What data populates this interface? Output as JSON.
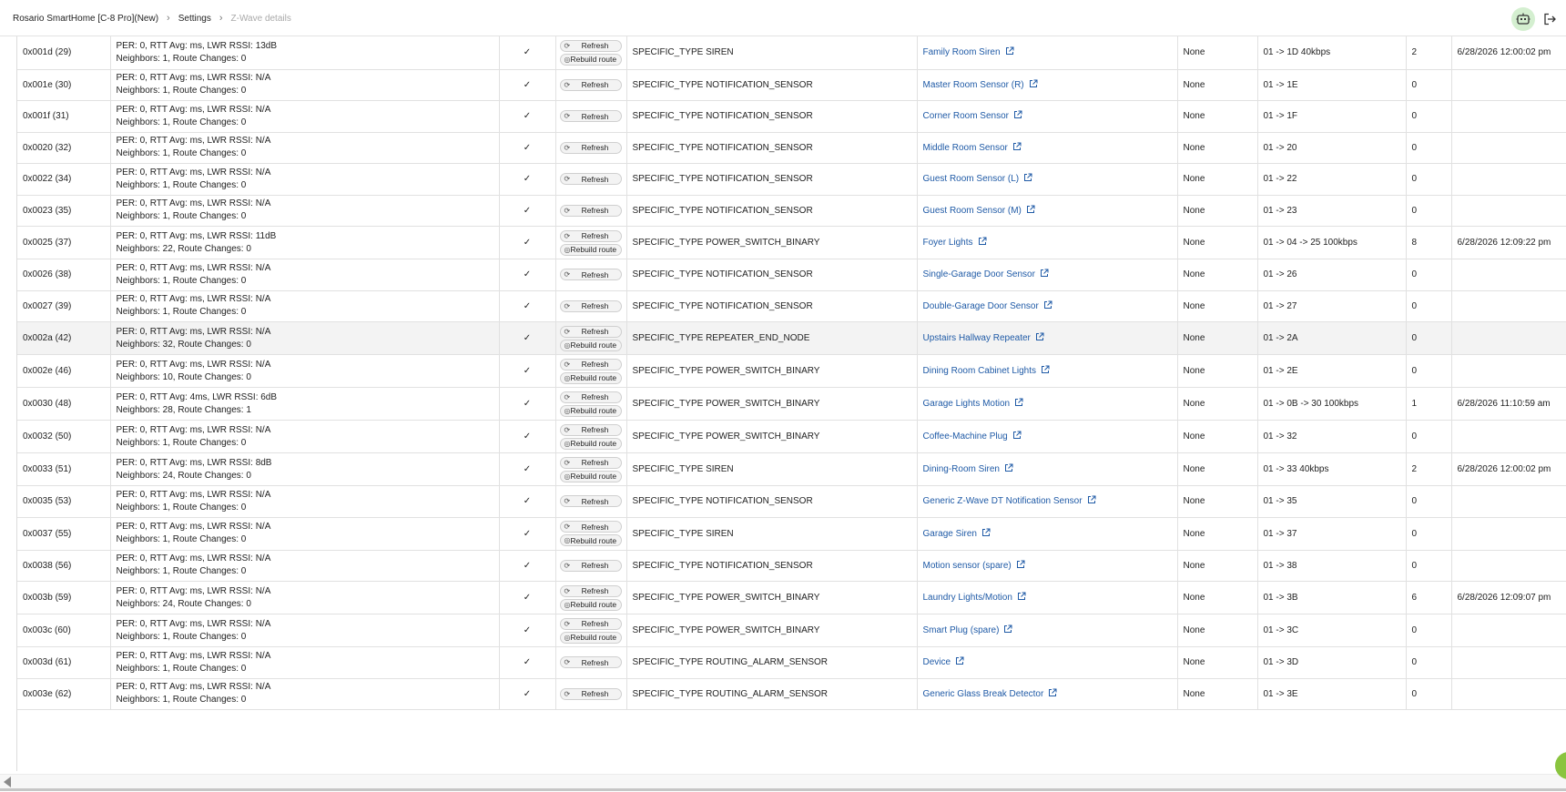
{
  "breadcrumb": {
    "hub": "Rosario SmartHome [C-8 Pro](New)",
    "settings": "Settings",
    "current": "Z-Wave details"
  },
  "header_icons": {
    "assistant": "robot-icon",
    "logout": "logout-icon",
    "assistant_bg": "#d4efd0"
  },
  "buttons": {
    "refresh": "Refresh",
    "rebuild": "Rebuild route"
  },
  "colors": {
    "link": "#1f5aa6",
    "highlight_row": "#f3f3f3",
    "fab": "#8ac43f"
  },
  "rows": [
    {
      "id": "0x001d (29)",
      "stats1": "PER: 0, RTT Avg: ms, LWR RSSI: 13dB",
      "stats2": "Neighbors: 1, Route Changes: 0",
      "ok": "✓",
      "rebuild": true,
      "type": "SPECIFIC_TYPE SIREN",
      "device": "Family Room Siren",
      "security": "None",
      "route": "01 -> 1D 40kbps",
      "count": "2",
      "time": "6/28/2026 12:00:02 pm"
    },
    {
      "id": "0x001e (30)",
      "stats1": "PER: 0, RTT Avg: ms, LWR RSSI: N/A",
      "stats2": "Neighbors: 1, Route Changes: 0",
      "ok": "✓",
      "rebuild": false,
      "type": "SPECIFIC_TYPE NOTIFICATION_SENSOR",
      "device": "Master Room Sensor (R)",
      "security": "None",
      "route": "01 -> 1E",
      "count": "0",
      "time": ""
    },
    {
      "id": "0x001f (31)",
      "stats1": "PER: 0, RTT Avg: ms, LWR RSSI: N/A",
      "stats2": "Neighbors: 1, Route Changes: 0",
      "ok": "✓",
      "rebuild": false,
      "type": "SPECIFIC_TYPE NOTIFICATION_SENSOR",
      "device": "Corner Room Sensor",
      "security": "None",
      "route": "01 -> 1F",
      "count": "0",
      "time": ""
    },
    {
      "id": "0x0020 (32)",
      "stats1": "PER: 0, RTT Avg: ms, LWR RSSI: N/A",
      "stats2": "Neighbors: 1, Route Changes: 0",
      "ok": "✓",
      "rebuild": false,
      "type": "SPECIFIC_TYPE NOTIFICATION_SENSOR",
      "device": "Middle Room Sensor",
      "security": "None",
      "route": "01 -> 20",
      "count": "0",
      "time": ""
    },
    {
      "id": "0x0022 (34)",
      "stats1": "PER: 0, RTT Avg: ms, LWR RSSI: N/A",
      "stats2": "Neighbors: 1, Route Changes: 0",
      "ok": "✓",
      "rebuild": false,
      "type": "SPECIFIC_TYPE NOTIFICATION_SENSOR",
      "device": "Guest Room Sensor (L)",
      "security": "None",
      "route": "01 -> 22",
      "count": "0",
      "time": ""
    },
    {
      "id": "0x0023 (35)",
      "stats1": "PER: 0, RTT Avg: ms, LWR RSSI: N/A",
      "stats2": "Neighbors: 1, Route Changes: 0",
      "ok": "✓",
      "rebuild": false,
      "type": "SPECIFIC_TYPE NOTIFICATION_SENSOR",
      "device": "Guest Room Sensor (M)",
      "security": "None",
      "route": "01 -> 23",
      "count": "0",
      "time": ""
    },
    {
      "id": "0x0025 (37)",
      "stats1": "PER: 0, RTT Avg: ms, LWR RSSI: 11dB",
      "stats2": "Neighbors: 22, Route Changes: 0",
      "ok": "✓",
      "rebuild": true,
      "type": "SPECIFIC_TYPE POWER_SWITCH_BINARY",
      "device": "Foyer Lights",
      "security": "None",
      "route": "01 -> 04 -> 25 100kbps",
      "count": "8",
      "time": "6/28/2026 12:09:22 pm"
    },
    {
      "id": "0x0026 (38)",
      "stats1": "PER: 0, RTT Avg: ms, LWR RSSI: N/A",
      "stats2": "Neighbors: 1, Route Changes: 0",
      "ok": "✓",
      "rebuild": false,
      "type": "SPECIFIC_TYPE NOTIFICATION_SENSOR",
      "device": "Single-Garage Door Sensor",
      "security": "None",
      "route": "01 -> 26",
      "count": "0",
      "time": ""
    },
    {
      "id": "0x0027 (39)",
      "stats1": "PER: 0, RTT Avg: ms, LWR RSSI: N/A",
      "stats2": "Neighbors: 1, Route Changes: 0",
      "ok": "✓",
      "rebuild": false,
      "type": "SPECIFIC_TYPE NOTIFICATION_SENSOR",
      "device": "Double-Garage Door Sensor",
      "security": "None",
      "route": "01 -> 27",
      "count": "0",
      "time": ""
    },
    {
      "id": "0x002a (42)",
      "stats1": "PER: 0, RTT Avg: ms, LWR RSSI: N/A",
      "stats2": "Neighbors: 32, Route Changes: 0",
      "ok": "✓",
      "rebuild": true,
      "type": "SPECIFIC_TYPE REPEATER_END_NODE",
      "device": "Upstairs Hallway Repeater",
      "security": "None",
      "route": "01 -> 2A",
      "count": "0",
      "time": "",
      "highlight": true
    },
    {
      "id": "0x002e (46)",
      "stats1": "PER: 0, RTT Avg: ms, LWR RSSI: N/A",
      "stats2": "Neighbors: 10, Route Changes: 0",
      "ok": "✓",
      "rebuild": true,
      "type": "SPECIFIC_TYPE POWER_SWITCH_BINARY",
      "device": "Dining Room Cabinet Lights",
      "security": "None",
      "route": "01 -> 2E",
      "count": "0",
      "time": ""
    },
    {
      "id": "0x0030 (48)",
      "stats1": "PER: 0, RTT Avg: 4ms, LWR RSSI: 6dB",
      "stats2": "Neighbors: 28, Route Changes: 1",
      "ok": "✓",
      "rebuild": true,
      "type": "SPECIFIC_TYPE POWER_SWITCH_BINARY",
      "device": "Garage Lights Motion",
      "security": "None",
      "route": "01 -> 0B -> 30 100kbps",
      "count": "1",
      "time": "6/28/2026 11:10:59 am"
    },
    {
      "id": "0x0032 (50)",
      "stats1": "PER: 0, RTT Avg: ms, LWR RSSI: N/A",
      "stats2": "Neighbors: 1, Route Changes: 0",
      "ok": "✓",
      "rebuild": true,
      "type": "SPECIFIC_TYPE POWER_SWITCH_BINARY",
      "device": "Coffee-Machine Plug",
      "security": "None",
      "route": "01 -> 32",
      "count": "0",
      "time": ""
    },
    {
      "id": "0x0033 (51)",
      "stats1": "PER: 0, RTT Avg: ms, LWR RSSI: 8dB",
      "stats2": "Neighbors: 24, Route Changes: 0",
      "ok": "✓",
      "rebuild": true,
      "type": "SPECIFIC_TYPE SIREN",
      "device": "Dining-Room Siren",
      "security": "None",
      "route": "01 -> 33 40kbps",
      "count": "2",
      "time": "6/28/2026 12:00:02 pm"
    },
    {
      "id": "0x0035 (53)",
      "stats1": "PER: 0, RTT Avg: ms, LWR RSSI: N/A",
      "stats2": "Neighbors: 1, Route Changes: 0",
      "ok": "✓",
      "rebuild": false,
      "type": "SPECIFIC_TYPE NOTIFICATION_SENSOR",
      "device": "Generic Z-Wave DT Notification Sensor",
      "security": "None",
      "route": "01 -> 35",
      "count": "0",
      "time": ""
    },
    {
      "id": "0x0037 (55)",
      "stats1": "PER: 0, RTT Avg: ms, LWR RSSI: N/A",
      "stats2": "Neighbors: 1, Route Changes: 0",
      "ok": "✓",
      "rebuild": true,
      "type": "SPECIFIC_TYPE SIREN",
      "device": "Garage Siren",
      "security": "None",
      "route": "01 -> 37",
      "count": "0",
      "time": ""
    },
    {
      "id": "0x0038 (56)",
      "stats1": "PER: 0, RTT Avg: ms, LWR RSSI: N/A",
      "stats2": "Neighbors: 1, Route Changes: 0",
      "ok": "✓",
      "rebuild": false,
      "type": "SPECIFIC_TYPE NOTIFICATION_SENSOR",
      "device": "Motion sensor (spare)",
      "security": "None",
      "route": "01 -> 38",
      "count": "0",
      "time": ""
    },
    {
      "id": "0x003b (59)",
      "stats1": "PER: 0, RTT Avg: ms, LWR RSSI: N/A",
      "stats2": "Neighbors: 24, Route Changes: 0",
      "ok": "✓",
      "rebuild": true,
      "type": "SPECIFIC_TYPE POWER_SWITCH_BINARY",
      "device": "Laundry Lights/Motion",
      "security": "None",
      "route": "01 -> 3B",
      "count": "6",
      "time": "6/28/2026 12:09:07 pm"
    },
    {
      "id": "0x003c (60)",
      "stats1": "PER: 0, RTT Avg: ms, LWR RSSI: N/A",
      "stats2": "Neighbors: 1, Route Changes: 0",
      "ok": "✓",
      "rebuild": true,
      "type": "SPECIFIC_TYPE POWER_SWITCH_BINARY",
      "device": "Smart Plug (spare)",
      "security": "None",
      "route": "01 -> 3C",
      "count": "0",
      "time": ""
    },
    {
      "id": "0x003d (61)",
      "stats1": "PER: 0, RTT Avg: ms, LWR RSSI: N/A",
      "stats2": "Neighbors: 1, Route Changes: 0",
      "ok": "✓",
      "rebuild": false,
      "type": "SPECIFIC_TYPE ROUTING_ALARM_SENSOR",
      "device": "Device",
      "security": "None",
      "route": "01 -> 3D",
      "count": "0",
      "time": ""
    },
    {
      "id": "0x003e (62)",
      "stats1": "PER: 0, RTT Avg: ms, LWR RSSI: N/A",
      "stats2": "Neighbors: 1, Route Changes: 0",
      "ok": "✓",
      "rebuild": false,
      "type": "SPECIFIC_TYPE ROUTING_ALARM_SENSOR",
      "device": "Generic Glass Break Detector",
      "security": "None",
      "route": "01 -> 3E",
      "count": "0",
      "time": ""
    }
  ]
}
